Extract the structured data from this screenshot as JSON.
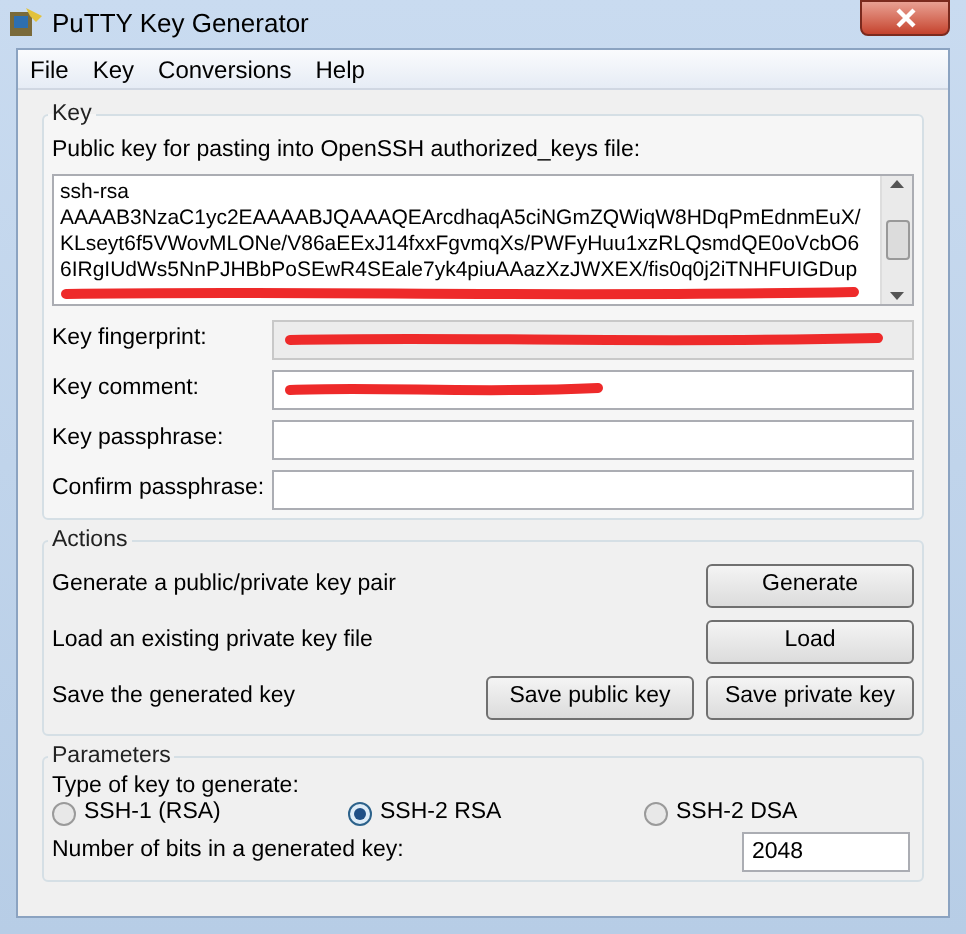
{
  "window": {
    "title": "PuTTY Key Generator"
  },
  "menu": [
    "File",
    "Key",
    "Conversions",
    "Help"
  ],
  "key": {
    "title": "Key",
    "public_key_label": "Public key for pasting into OpenSSH authorized_keys file:",
    "public_key_lines": [
      "ssh-rsa",
      "AAAAB3NzaC1yc2EAAAABJQAAAQEArcdhaqA5ciNGmZQWiqW8HDqPmEdnmEuX/",
      "KLseyt6f5VWovMLONe/V86aEExJ14fxxFgvmqXs/PWFyHuu1xzRLQsmdQE0oVcbO6",
      "6IRgIUdWs5NnPJHBbPoSEwR4SEale7yk4piuAAazXzJWXEX/fis0q0j2iTNHFUIGDup"
    ],
    "public_key_redacted": true,
    "fields": [
      {
        "label": "Key fingerprint:",
        "readonly": true,
        "redacted": true
      },
      {
        "label": "Key comment:",
        "readonly": false,
        "redacted": true
      },
      {
        "label": "Key passphrase:",
        "readonly": false,
        "redacted": false
      },
      {
        "label": "Confirm passphrase:",
        "readonly": false,
        "redacted": false
      }
    ]
  },
  "actions": {
    "title": "Actions",
    "rows": [
      {
        "label": "Generate a public/private key pair",
        "buttons": [
          "Generate"
        ]
      },
      {
        "label": "Load an existing private key file",
        "buttons": [
          "Load"
        ]
      },
      {
        "label": "Save the generated key",
        "buttons": [
          "Save public key",
          "Save private key"
        ]
      }
    ]
  },
  "parameters": {
    "title": "Parameters",
    "type_label": "Type of key to generate:",
    "key_types": [
      {
        "label": "SSH-1 (RSA)",
        "selected": false
      },
      {
        "label": "SSH-2 RSA",
        "selected": true
      },
      {
        "label": "SSH-2 DSA",
        "selected": false
      }
    ],
    "bits_label": "Number of bits in a generated key:",
    "bits": "2048"
  }
}
